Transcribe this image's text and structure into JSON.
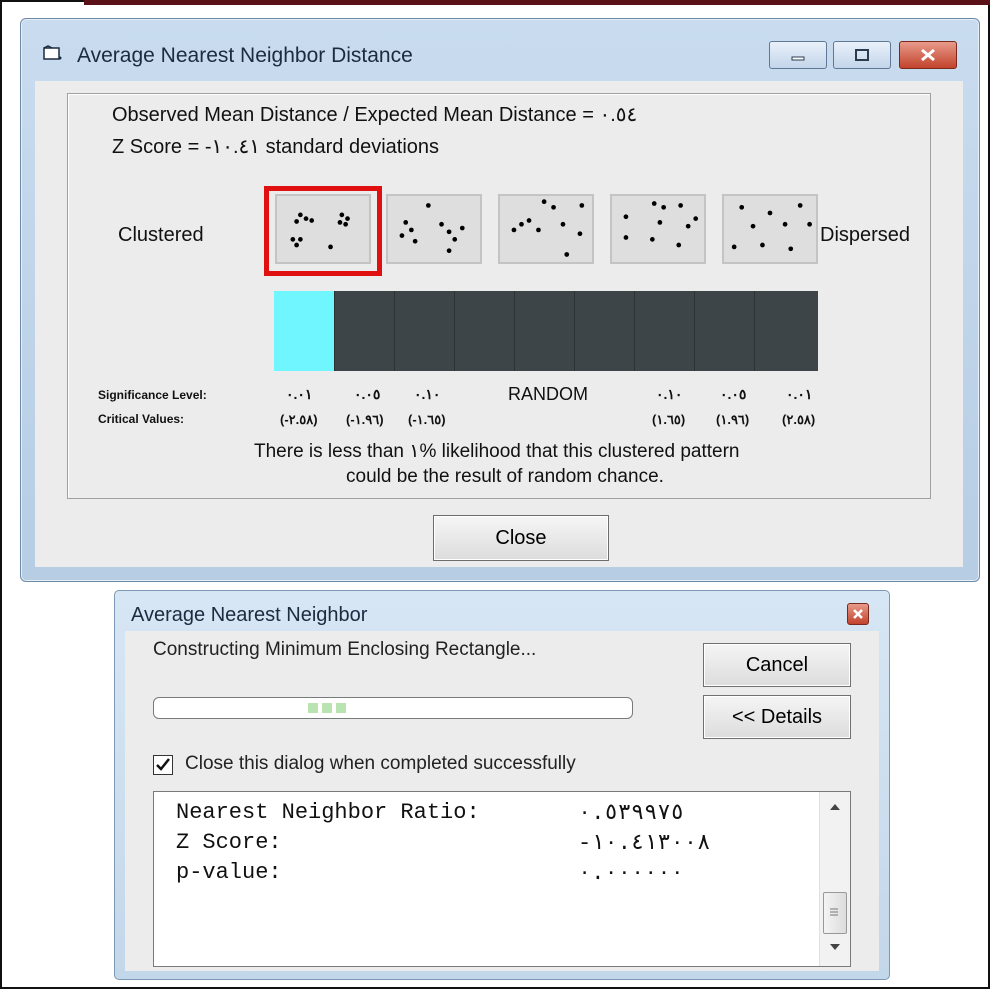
{
  "main_window": {
    "title": "Average Nearest Neighbor Distance",
    "observed_line": "Observed Mean Distance / Expected Mean Distance = ٠.٥٤",
    "zscore_line": "Z Score = -١٠.٤١ standard deviations",
    "left_label": "Clustered",
    "right_label": "Dispersed",
    "selected_pattern_index": 0,
    "significance_label": "Significance Level:",
    "critical_label": "Critical Values:",
    "significance_levels": [
      "٠.٠١",
      "٠.٠٥",
      "٠.١٠",
      "RANDOM",
      "٠.١٠",
      "٠.٠٥",
      "٠.٠١"
    ],
    "critical_values": [
      "(-٢.٥٨)",
      "(-١.٩٦)",
      "(-١.٦٥)",
      "(١.٦٥)",
      "(١.٩٦)",
      "(٢.٥٨)"
    ],
    "message_line1": "There is less than ١% likelihood that this clustered pattern",
    "message_line2": "could be the result of random chance.",
    "close_button": "Close",
    "highlight_color": "#6ff6ff",
    "selection_color": "#e01010"
  },
  "progress_window": {
    "title": "Average Nearest Neighbor",
    "status": "Constructing Minimum Enclosing Rectangle...",
    "cancel_button": "Cancel",
    "details_button": "<< Details",
    "checkbox_label": "Close this dialog when completed successfully",
    "checkbox_checked": true,
    "results": [
      {
        "label": "Nearest Neighbor Ratio:",
        "value": "٠.٥٣٩٩٧٥"
      },
      {
        "label": "Z Score:",
        "value": "-١٠.٤١٣٠٠٨"
      },
      {
        "label": "p-value:",
        "value": "٠.٠٠٠٠٠٠"
      }
    ]
  }
}
